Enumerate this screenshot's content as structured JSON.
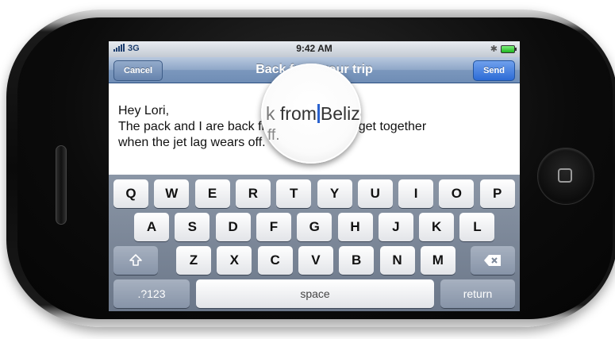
{
  "status_bar": {
    "carrier": "3G",
    "time": "9:42 AM",
    "bluetooth_icon": "bluetooth-icon",
    "battery_icon": "battery-icon"
  },
  "nav": {
    "title": "Back from your trip",
    "cancel_label": "Cancel",
    "send_label": "Send"
  },
  "message": {
    "line1": "Hey Lori,",
    "line2": "The pack and I are back from Belize. Let's get together",
    "line3": "when the jet lag wears off."
  },
  "loupe": {
    "before": "k",
    "word": "from",
    "after": "Belize",
    "second_line": "ff."
  },
  "keyboard": {
    "row1": [
      "Q",
      "W",
      "E",
      "R",
      "T",
      "Y",
      "U",
      "I",
      "O",
      "P"
    ],
    "row2": [
      "A",
      "S",
      "D",
      "F",
      "G",
      "H",
      "J",
      "K",
      "L"
    ],
    "row3": [
      "Z",
      "X",
      "C",
      "V",
      "B",
      "N",
      "M"
    ],
    "shift_icon": "shift-icon",
    "delete_icon": "delete-icon",
    "numbers_label": ".?123",
    "space_label": "space",
    "return_label": "return"
  },
  "colors": {
    "nav_blue": "#7b97bd",
    "send_blue": "#2c6bd6",
    "caret_blue": "#2a62cf"
  }
}
